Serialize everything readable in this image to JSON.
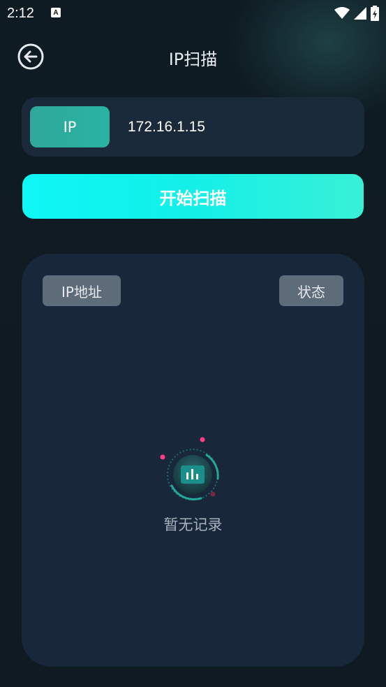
{
  "status_bar": {
    "time": "2:12",
    "notification_glyph": "A",
    "icons": [
      "wifi-icon",
      "signal-icon",
      "battery-icon"
    ]
  },
  "header": {
    "title": "IP扫描",
    "back_icon": "back-arrow-icon"
  },
  "ip_row": {
    "label": "IP",
    "value": "172.16.1.15"
  },
  "scan_button": {
    "label": "开始扫描"
  },
  "results": {
    "columns": [
      "IP地址",
      "状态"
    ],
    "empty_text": "暂无记录",
    "empty_icon": "bar-chart-icon"
  },
  "colors": {
    "background": "#0f1a22",
    "panel": "#18283a",
    "accent_teal": "#2ab3a3",
    "button_cyan": "#0ef6f6",
    "header_chip": "#5e6b78",
    "dot_pink": "#ff3d7f"
  }
}
